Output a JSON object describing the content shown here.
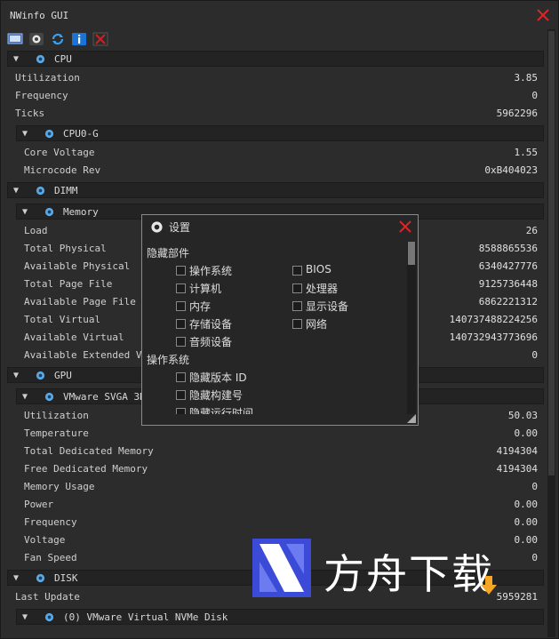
{
  "window": {
    "title": "NWinfo GUI"
  },
  "toolbar": {
    "icons": [
      "monitor-icon",
      "settings-icon",
      "refresh-icon",
      "info-icon",
      "close-icon"
    ],
    "colors": {
      "blue": "#1b73d6",
      "red": "#d02020"
    }
  },
  "sections": [
    {
      "id": "cpu",
      "label": "CPU",
      "depth": 0
    },
    {
      "id": "cpu0",
      "label": "CPU0-G",
      "depth": 1
    },
    {
      "id": "dimm",
      "label": "DIMM",
      "depth": 0
    },
    {
      "id": "memory",
      "label": "Memory",
      "depth": 1
    },
    {
      "id": "gpu",
      "label": "GPU",
      "depth": 0
    },
    {
      "id": "svga",
      "label": "VMware SVGA 3D",
      "depth": 1
    },
    {
      "id": "disk",
      "label": "DISK",
      "depth": 0
    },
    {
      "id": "nvme",
      "label": "(0) VMware Virtual NVMe Disk",
      "depth": 1
    }
  ],
  "rows": {
    "cpu": [
      {
        "k": "Utilization",
        "v": "3.85"
      },
      {
        "k": "Frequency",
        "v": "0"
      },
      {
        "k": "Ticks",
        "v": "5962296"
      }
    ],
    "cpu0": [
      {
        "k": "Core Voltage",
        "v": "1.55"
      },
      {
        "k": "Microcode Rev",
        "v": "0xB404023"
      }
    ],
    "memory": [
      {
        "k": "Load",
        "v": "26"
      },
      {
        "k": "Total Physical",
        "v": "8588865536"
      },
      {
        "k": "Available Physical",
        "v": "6340427776"
      },
      {
        "k": "Total Page File",
        "v": "9125736448"
      },
      {
        "k": "Available Page File",
        "v": "6862221312"
      },
      {
        "k": "Total Virtual",
        "v": "140737488224256"
      },
      {
        "k": "Available Virtual",
        "v": "140732943773696"
      },
      {
        "k": "Available Extended Vir",
        "v": "0"
      }
    ],
    "svga": [
      {
        "k": "Utilization",
        "v": "50.03"
      },
      {
        "k": "Temperature",
        "v": "0.00"
      },
      {
        "k": "Total Dedicated Memory",
        "v": "4194304"
      },
      {
        "k": "Free Dedicated Memory",
        "v": "4194304"
      },
      {
        "k": "Memory Usage",
        "v": "0"
      },
      {
        "k": "Power",
        "v": "0.00"
      },
      {
        "k": "Frequency",
        "v": "0.00"
      },
      {
        "k": "Voltage",
        "v": "0.00"
      },
      {
        "k": "Fan Speed",
        "v": "0"
      }
    ],
    "disk": [
      {
        "k": "Last Update",
        "v": "5959281"
      }
    ]
  },
  "dialog": {
    "title": "设置",
    "section_hide_components": "隐藏部件",
    "components": [
      {
        "label": "操作系统",
        "checked": false
      },
      {
        "label": "BIOS",
        "checked": false
      },
      {
        "label": "计算机",
        "checked": false
      },
      {
        "label": "处理器",
        "checked": false
      },
      {
        "label": "内存",
        "checked": false
      },
      {
        "label": "显示设备",
        "checked": false
      },
      {
        "label": "存储设备",
        "checked": false
      },
      {
        "label": "网络",
        "checked": false
      },
      {
        "label": "音频设备",
        "checked": false
      }
    ],
    "section_os": "操作系统",
    "os_options": [
      {
        "label": "隐藏版本 ID",
        "checked": false
      },
      {
        "label": "隐藏构建号",
        "checked": false
      },
      {
        "label": "隐藏运行时间",
        "checked": false
      }
    ]
  },
  "watermark": {
    "text": "方舟下载",
    "accent": "#f5a623",
    "logo_blue": "#3b4bd8"
  }
}
